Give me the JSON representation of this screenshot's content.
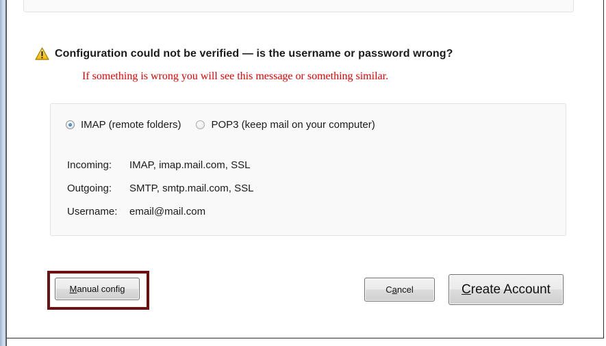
{
  "warning": {
    "icon": "warning-triangle-icon",
    "message": "Configuration could not be verified — is the username or password wrong?"
  },
  "annotation": {
    "text": "If something is wrong you will see this message or something similar.",
    "color": "#e80000"
  },
  "protocol": {
    "options": [
      {
        "label": "IMAP (remote folders)",
        "selected": true
      },
      {
        "label": "POP3 (keep mail on your computer)",
        "selected": false
      }
    ]
  },
  "settings": [
    {
      "label": "Incoming:",
      "value": "IMAP, imap.mail.com, SSL"
    },
    {
      "label": "Outgoing:",
      "value": "SMTP, smtp.mail.com, SSL"
    },
    {
      "label": "Username:",
      "value": "email@mail.com"
    }
  ],
  "buttons": {
    "manual_config": {
      "accesskey": "M",
      "rest": "anual config"
    },
    "cancel": {
      "before": "C",
      "accesskey": "a",
      "rest": "ncel"
    },
    "create_account": {
      "accesskey": "C",
      "rest": "reate Account"
    }
  },
  "highlight_color": "#6e0f12"
}
